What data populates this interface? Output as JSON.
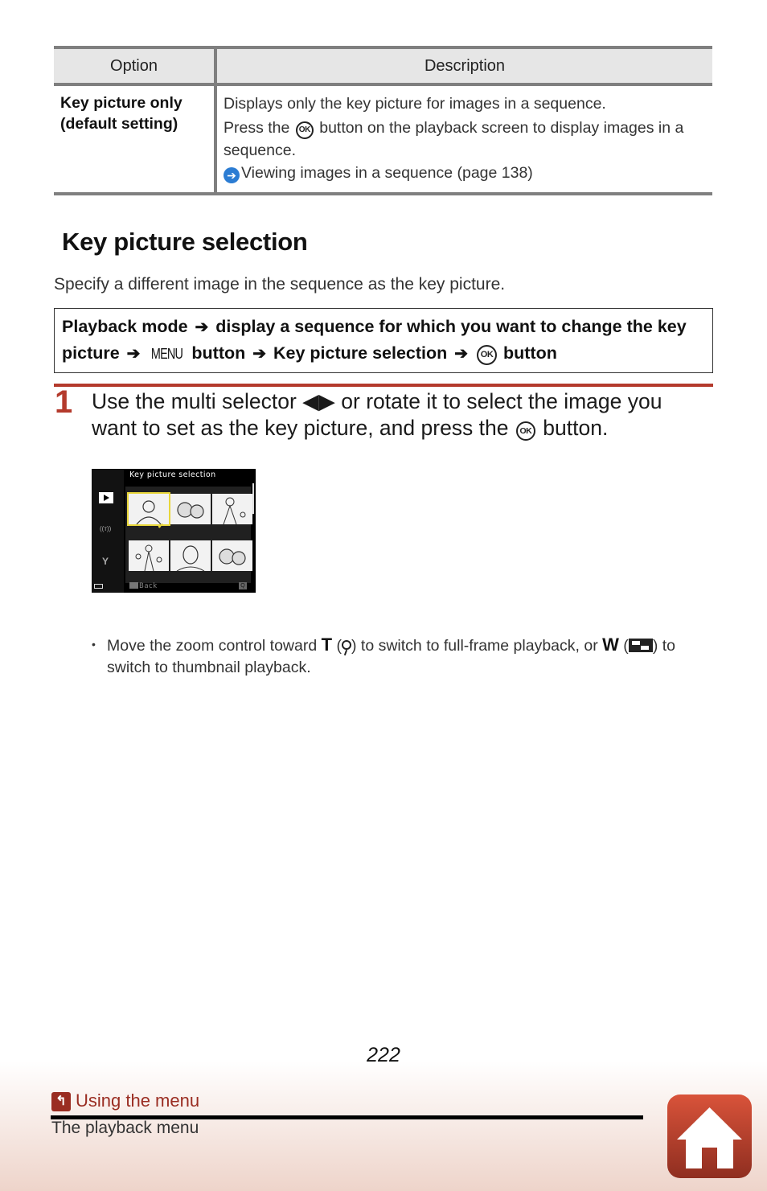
{
  "table": {
    "headers": [
      "Option",
      "Description"
    ],
    "rows": [
      {
        "option_line1": "Key picture only",
        "option_line2": "(default setting)",
        "desc_line1": "Displays only the key picture for images in a sequence.",
        "desc_press_before": "Press the",
        "desc_ok_glyph": "OK",
        "desc_press_after": "button on the playback screen to display images in a sequence.",
        "desc_link": "Viewing images in a sequence (page 138)"
      }
    ]
  },
  "section": {
    "title": "Key picture selection",
    "intro": "Specify a different image in the sequence as the key picture."
  },
  "nav_path": {
    "part1": "Playback mode",
    "part2": "display a sequence for which you want to change the key picture",
    "menu_glyph": "MENU",
    "part3": "button",
    "part4": "Key picture selection",
    "ok_glyph": "OK",
    "part5": "button",
    "arrow": "➔"
  },
  "step": {
    "number": "1",
    "text_before": "Use the multi selector ◀▶ or rotate it to select the image you want to set as the key picture, and press the",
    "ok_glyph": "OK",
    "text_after": "button."
  },
  "camera_screen": {
    "title": "Key picture selection",
    "back_label": "Back",
    "thumbnails": [
      {
        "subject": "woman portrait",
        "selected": true
      },
      {
        "subject": "flowers",
        "selected": false
      },
      {
        "subject": "woman with child",
        "selected": false
      },
      {
        "subject": "family walking",
        "selected": false
      },
      {
        "subject": "woman close-up",
        "selected": false
      },
      {
        "subject": "flowers",
        "selected": false
      }
    ],
    "side_icons": [
      "playback-icon",
      "wireless-icon",
      "setup-wrench-icon"
    ]
  },
  "note": {
    "text1": "Move the zoom control toward",
    "t_label": "T",
    "text2": "to switch to full-frame playback, or",
    "w_label": "W",
    "text3": "to switch to thumbnail playback."
  },
  "footer": {
    "page_number": "222",
    "crumb": "Using the menu",
    "subcrumb": "The playback menu"
  }
}
